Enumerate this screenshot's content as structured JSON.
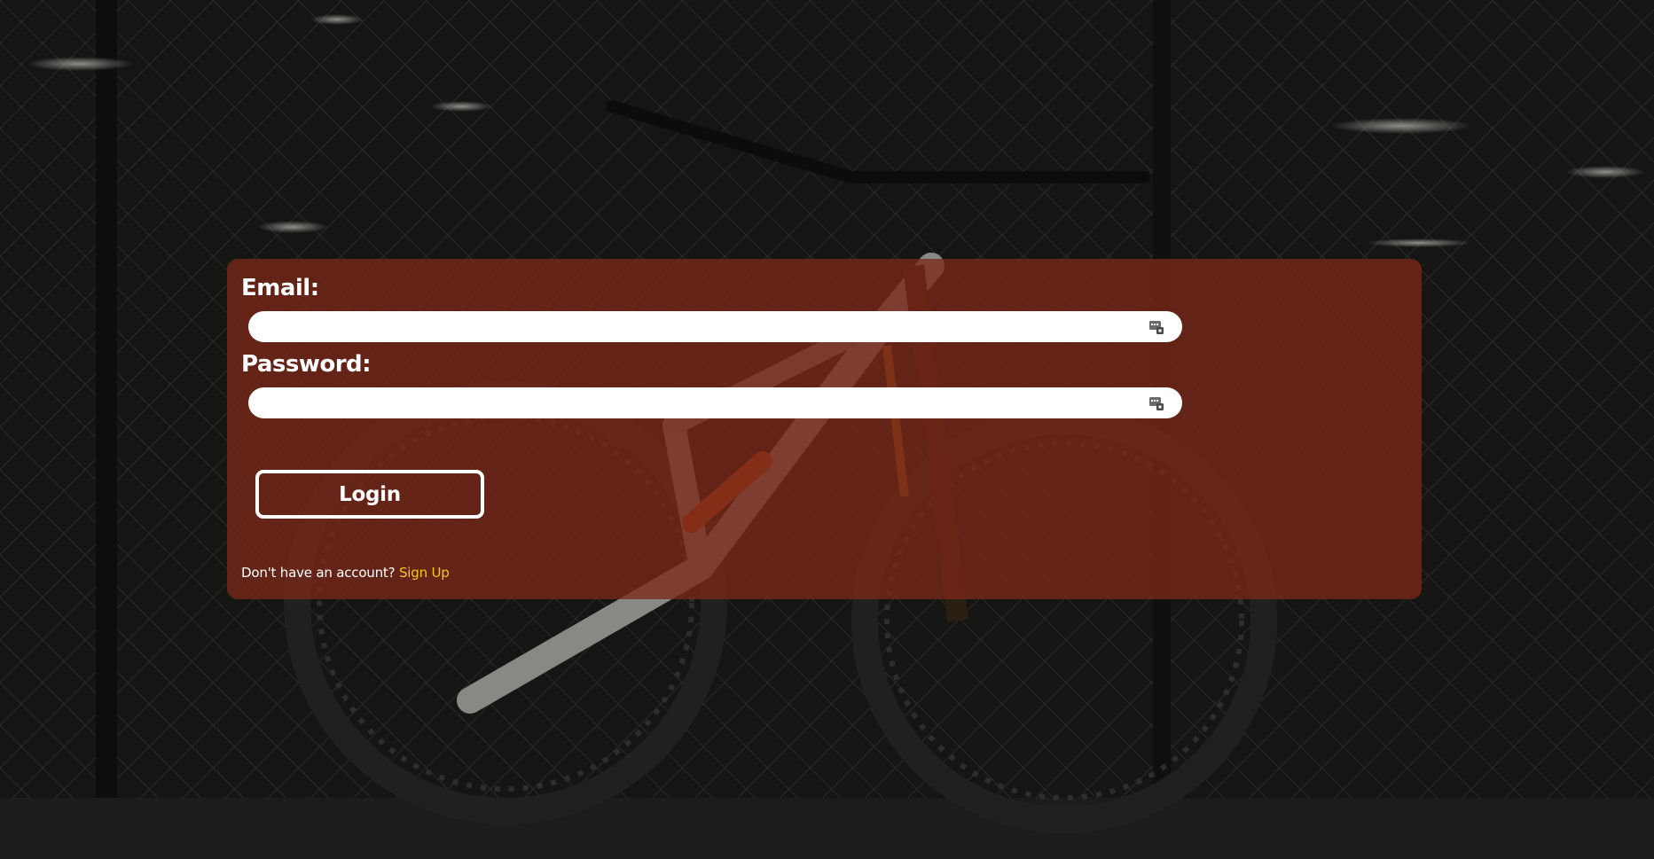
{
  "page": {
    "background_image": "mountain bike against chain-link fence at night"
  },
  "login_form": {
    "email_label": "Email:",
    "email_value": "",
    "password_label": "Password:",
    "password_value": "",
    "login_button": "Login",
    "signup_prompt": "Don't have an account?",
    "signup_link": "Sign Up"
  },
  "icons": {
    "email_field": "password-manager-key-icon",
    "password_field": "password-manager-key-icon"
  },
  "colors": {
    "panel": "#7a2818",
    "link": "#f5c518",
    "text": "#ffffff",
    "background": "#1f1f1e"
  }
}
